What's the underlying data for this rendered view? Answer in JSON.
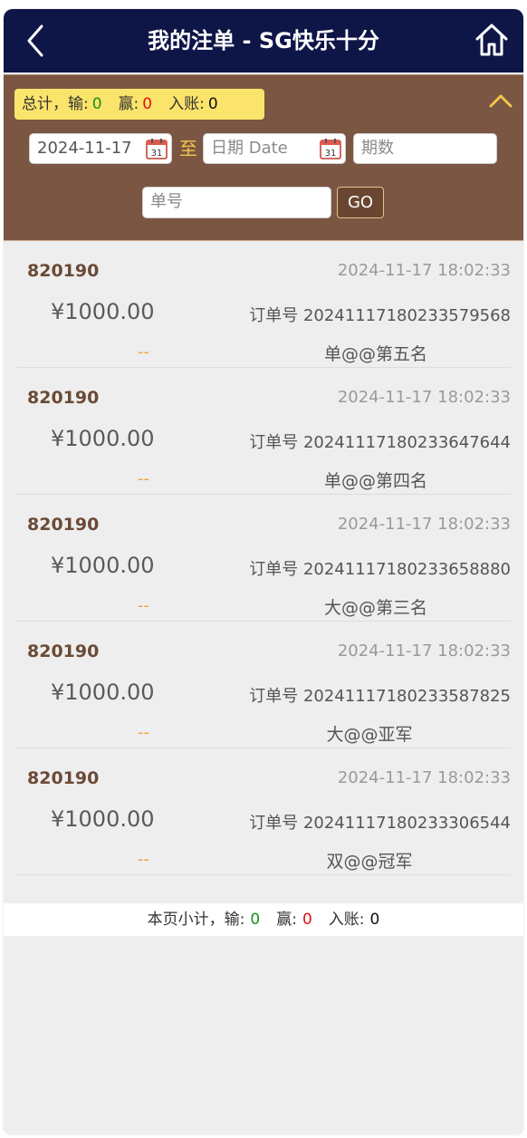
{
  "header": {
    "title": "我的注单 - SG快乐十分",
    "back_icon": "chevron-left-icon",
    "home_icon": "home-icon"
  },
  "filter": {
    "totals": {
      "prefix": "总计，输:",
      "lose_value": "0",
      "win_label": "赢:",
      "win_value": "0",
      "account_label": "入账:",
      "account_value": "0"
    },
    "start_date": "2024-11-17",
    "to_label": "至",
    "end_date_placeholder": "日期 Date",
    "period_placeholder": "期数",
    "order_placeholder": "单号",
    "go_label": "GO",
    "colors": {
      "panel": "#7a5643",
      "badge": "#fbe46b"
    }
  },
  "bets": [
    {
      "period": "820190",
      "time": "2024-11-17 18:02:33",
      "amount": "¥1000.00",
      "order": "订单号 20241117180233579568",
      "result": "--",
      "bet": "单@@第五名"
    },
    {
      "period": "820190",
      "time": "2024-11-17 18:02:33",
      "amount": "¥1000.00",
      "order": "订单号 20241117180233647644",
      "result": "--",
      "bet": "单@@第四名"
    },
    {
      "period": "820190",
      "time": "2024-11-17 18:02:33",
      "amount": "¥1000.00",
      "order": "订单号 20241117180233658880",
      "result": "--",
      "bet": "大@@第三名"
    },
    {
      "period": "820190",
      "time": "2024-11-17 18:02:33",
      "amount": "¥1000.00",
      "order": "订单号 20241117180233587825",
      "result": "--",
      "bet": "大@@亚军"
    },
    {
      "period": "820190",
      "time": "2024-11-17 18:02:33",
      "amount": "¥1000.00",
      "order": "订单号 20241117180233306544",
      "result": "--",
      "bet": "双@@冠军"
    }
  ],
  "subtotal": {
    "prefix": "本页小计，输:",
    "lose_value": "0",
    "win_label": "赢:",
    "win_value": "0",
    "account_label": "入账:",
    "account_value": "0"
  }
}
